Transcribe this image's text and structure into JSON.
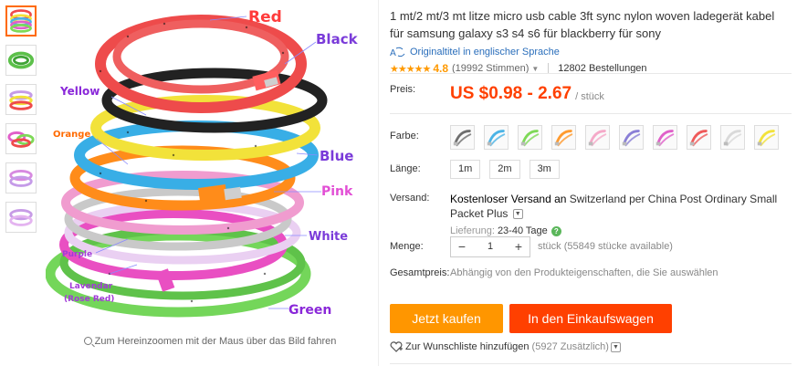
{
  "thumbnails": [
    {
      "name": "thumb-1",
      "active": true
    },
    {
      "name": "thumb-2",
      "active": false
    },
    {
      "name": "thumb-3",
      "active": false
    },
    {
      "name": "thumb-4",
      "active": false
    },
    {
      "name": "thumb-5",
      "active": false
    },
    {
      "name": "thumb-6",
      "active": false
    }
  ],
  "main_image": {
    "labels": {
      "red": "Red",
      "black": "Black",
      "yellow": "Yellow",
      "orange": "Orange",
      "blue": "Blue",
      "pink": "Pink",
      "white": "White",
      "purple": "Purple",
      "lavendar": "Lavendar",
      "rose_red": "(Rose Red)",
      "green": "Green"
    },
    "zoom_hint": "Zum Hereinzoomen mit der Maus über das Bild fahren"
  },
  "product": {
    "title": "1 mt/2 mt/3 mt litze micro usb cable 3ft sync nylon woven ladegerät kabel für samsung galaxy s3 s4 s6 für blackberry für sony",
    "translate_link": "Originaltitel in englischer Sprache",
    "stars": "★★★★★",
    "rating": "4.8",
    "votes": "(19992 Stimmen)",
    "orders": "12802 Bestellungen"
  },
  "price": {
    "label": "Preis:",
    "value": "US $0.98 - 2.67",
    "unit": "/ stück"
  },
  "color": {
    "label": "Farbe:",
    "swatches": [
      "#6e6e6e",
      "#4bb4e6",
      "#7ed957",
      "#ff9a2e",
      "#f5a9c8",
      "#8a7fd6",
      "#e05fc9",
      "#ef5a5a",
      "#d9d9d9",
      "#f2e23a"
    ]
  },
  "length": {
    "label": "Länge:",
    "options": [
      "1m",
      "2m",
      "3m"
    ]
  },
  "shipping": {
    "label": "Versand:",
    "line": "Kostenloser Versand an",
    "rest": "Switzerland per China Post Ordinary Small Packet Plus",
    "delivery_label": "Lieferung:",
    "delivery_days": "23-40 Tage"
  },
  "quantity": {
    "label": "Menge:",
    "value": "1",
    "minus": "−",
    "plus": "+",
    "stock": "stück (55849 stücke available)"
  },
  "total": {
    "label": "Gesamtpreis:",
    "note": "Abhängig von den Produkteigenschaften, die Sie auswählen"
  },
  "actions": {
    "buy_now": "Jetzt kaufen",
    "add_to_cart": "In den Einkaufswagen",
    "wishlist": "Zur Wunschliste hinzufügen",
    "wishlist_count": "(5927 Zusätzlich)"
  },
  "colors": {
    "accent_orange": "#ff9600",
    "accent_red": "#ff4000",
    "link_blue": "#2a6ebb",
    "star": "#ff9900"
  }
}
